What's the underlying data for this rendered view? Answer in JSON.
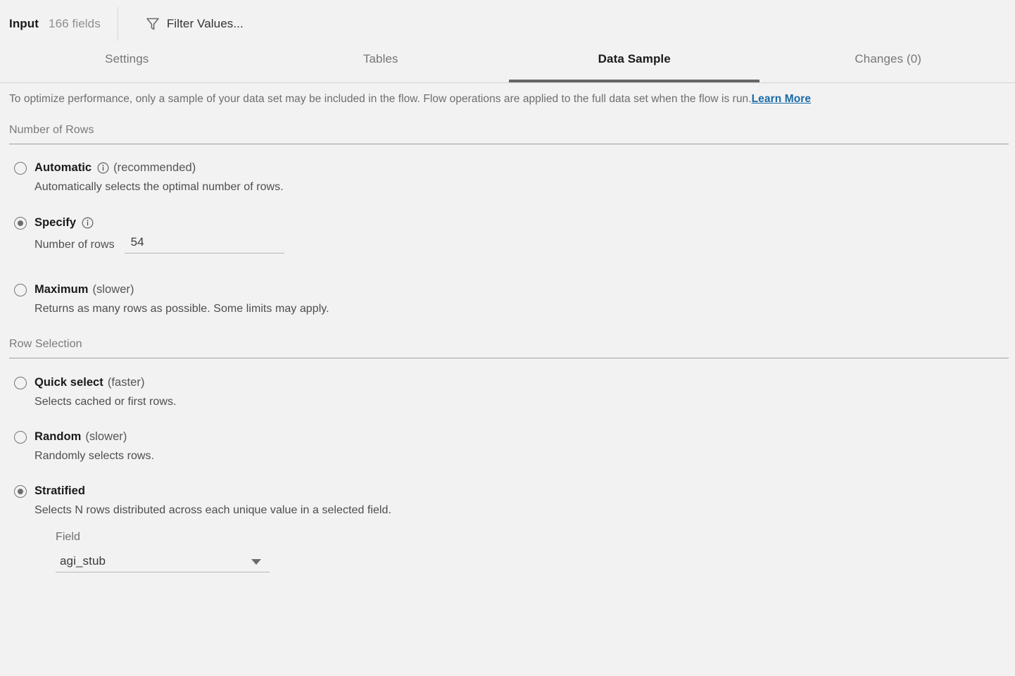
{
  "header": {
    "title": "Input",
    "fields_count": "166 fields",
    "filter_label": "Filter Values...",
    "filter_icon": "filter-funnel-icon"
  },
  "tabs": [
    {
      "label": "Settings",
      "active": false
    },
    {
      "label": "Tables",
      "active": false
    },
    {
      "label": "Data Sample",
      "active": true
    },
    {
      "label": "Changes (0)",
      "active": false
    }
  ],
  "notice": {
    "text": "To optimize performance, only a sample of your data set may be included in the flow. Flow operations are applied to the full data set when the flow is run.",
    "link_label": "Learn More",
    "link_color": "#1a6ba6"
  },
  "number_of_rows": {
    "section_title": "Number of Rows",
    "options": [
      {
        "name": "Automatic",
        "suffix": "(recommended)",
        "description": "Automatically selects the optimal number of rows.",
        "has_info_icon": true,
        "selected": false
      },
      {
        "name": "Specify",
        "suffix": "",
        "description": "",
        "has_info_icon": true,
        "selected": true
      },
      {
        "name": "Maximum",
        "suffix": "(slower)",
        "description": "Returns as many rows as possible. Some limits may apply.",
        "has_info_icon": false,
        "selected": false
      }
    ],
    "rows_field": {
      "label": "Number of rows",
      "value": "54",
      "placeholder": ""
    }
  },
  "row_selection": {
    "section_title": "Row Selection",
    "options": [
      {
        "name": "Quick select",
        "suffix": "(faster)",
        "description": "Selects cached or first rows.",
        "selected": false
      },
      {
        "name": "Random",
        "suffix": "(slower)",
        "description": "Randomly selects rows.",
        "selected": false
      },
      {
        "name": "Stratified",
        "suffix": "",
        "description": "Selects N rows distributed across each unique value in a selected field.",
        "selected": true
      }
    ],
    "field_select": {
      "label": "Field",
      "value": "agi_stub",
      "caret_icon": "chevron-down-icon"
    }
  },
  "colors": {
    "background": "#f2f2f2",
    "active_tab_underline": "#666666",
    "link": "#1a6ba6",
    "radio_border": "#767676"
  }
}
